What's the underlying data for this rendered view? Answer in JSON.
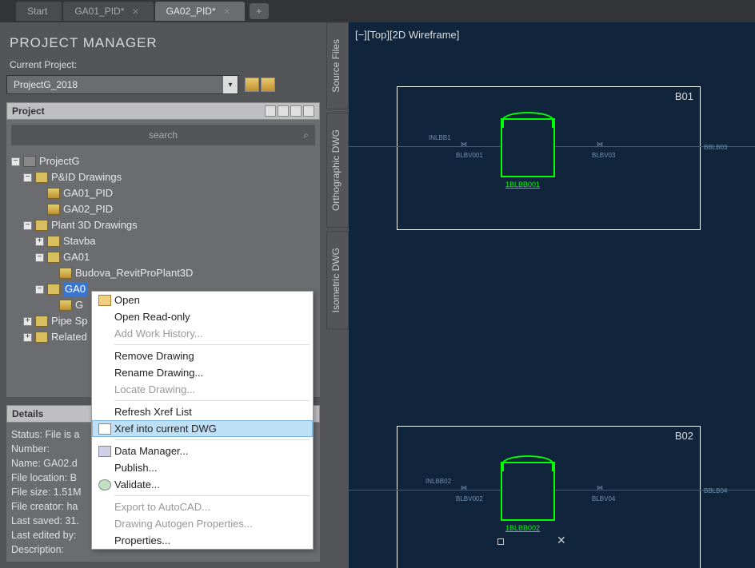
{
  "tabs": {
    "items": [
      {
        "label": "Start",
        "closable": false
      },
      {
        "label": "GA01_PID*",
        "closable": true
      },
      {
        "label": "GA02_PID*",
        "closable": true
      }
    ],
    "active_index": 2
  },
  "project_manager": {
    "title": "PROJECT MANAGER",
    "current_project_label": "Current Project:",
    "current_project_value": "ProjectG_2018",
    "project_header": "Project",
    "search_placeholder": "search",
    "tree": {
      "root": "ProjectG",
      "pid_folder": "P&ID Drawings",
      "pid_items": [
        "GA01_PID",
        "GA02_PID"
      ],
      "p3d_folder": "Plant 3D Drawings",
      "stavba": "Stavba",
      "ga01": "GA01",
      "budova": "Budova_RevitProPlant3D",
      "ga02_partial": "GA0",
      "ga02_child_partial": "G",
      "pipe_specs": "Pipe Sp",
      "related": "Related"
    },
    "details_header": "Details",
    "details": {
      "status": "Status: File is a",
      "number": "Number:",
      "name": "Name: GA02.d",
      "location": "File location: B",
      "size": "File size: 1.51M",
      "creator": "File creator: ha",
      "saved": "Last saved: 31.",
      "edited": "Last edited by:",
      "description": "Description:"
    }
  },
  "context_menu": {
    "items": [
      {
        "label": "Open",
        "icon": "open-icon"
      },
      {
        "label": "Open Read-only"
      },
      {
        "label": "Add Work History...",
        "disabled": true
      },
      {
        "sep": true
      },
      {
        "label": "Remove Drawing"
      },
      {
        "label": "Rename Drawing..."
      },
      {
        "label": "Locate Drawing...",
        "disabled": true
      },
      {
        "sep": true
      },
      {
        "label": "Refresh Xref List"
      },
      {
        "label": "Xref into current DWG",
        "highlighted": true,
        "icon": "xref-icon"
      },
      {
        "sep": true
      },
      {
        "label": "Data Manager...",
        "icon": "data-icon"
      },
      {
        "label": "Publish..."
      },
      {
        "label": "Validate...",
        "icon": "validate-icon"
      },
      {
        "sep": true
      },
      {
        "label": "Export to AutoCAD...",
        "disabled": true
      },
      {
        "label": "Drawing Autogen Properties...",
        "disabled": true
      },
      {
        "label": "Properties..."
      }
    ]
  },
  "side_tabs": [
    "Source Files",
    "Orthographic DWG",
    "Isometric DWG"
  ],
  "viewport": {
    "view_label": "[−][Top][2D Wireframe]",
    "boxes": [
      {
        "label": "B01",
        "tank_label": "1BLBB001"
      },
      {
        "label": "B02",
        "tank_label": "1BLBB002"
      }
    ],
    "pid_labels": {
      "inlbb1": "INLBB1",
      "inlbb2": "INLBB02",
      "blbv01": "BLBV001",
      "blbv02": "BLBV002",
      "blbv03": "BLBV03",
      "blbv04": "BLBV04"
    }
  }
}
